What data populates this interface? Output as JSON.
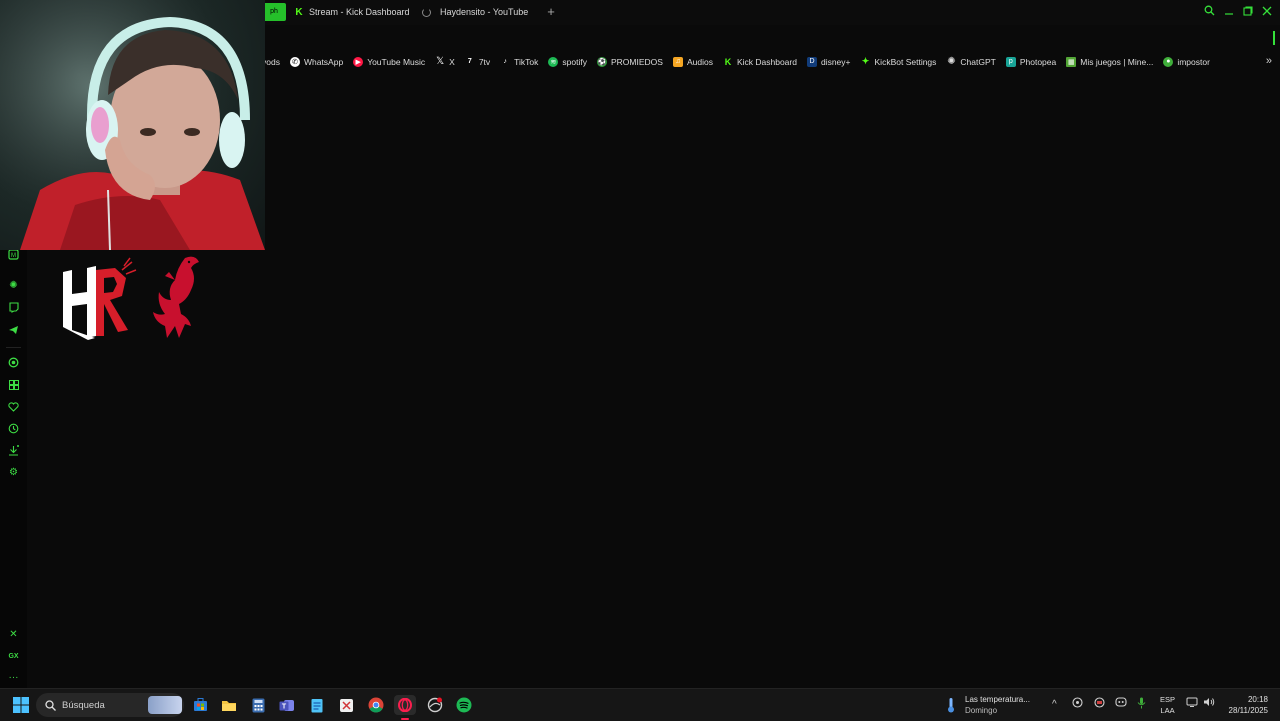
{
  "browser": {
    "active_tab_short": "ph",
    "tabs": [
      {
        "title": "Stream - Kick Dashboard",
        "icon": "kick-icon"
      },
      {
        "title": "Haydensito - YouTube",
        "icon": "loading-spinner-icon"
      }
    ],
    "new_tab_symbol": "+"
  },
  "bookmarks": [
    {
      "label": "vods",
      "icon": "kick-icon"
    },
    {
      "label": "WhatsApp",
      "icon": "whatsapp-icon"
    },
    {
      "label": "YouTube Music",
      "icon": "youtube-music-icon"
    },
    {
      "label": "X",
      "icon": "x-icon"
    },
    {
      "label": "7tv",
      "icon": "7tv-icon"
    },
    {
      "label": "TikTok",
      "icon": "tiktok-icon"
    },
    {
      "label": "spotify",
      "icon": "spotify-icon"
    },
    {
      "label": "PROMIEDOS",
      "icon": "promiedos-icon"
    },
    {
      "label": "Audios",
      "icon": "audios-icon"
    },
    {
      "label": "Kick Dashboard",
      "icon": "kick-icon"
    },
    {
      "label": "disney+",
      "icon": "disney-icon"
    },
    {
      "label": "KickBot Settings",
      "icon": "kickbot-icon"
    },
    {
      "label": "ChatGPT",
      "icon": "chatgpt-icon"
    },
    {
      "label": "Photopea",
      "icon": "photopea-icon"
    },
    {
      "label": "Mis juegos | Mine...",
      "icon": "minecraft-icon"
    },
    {
      "label": "impostor",
      "icon": "impostor-icon"
    }
  ],
  "logo": {
    "text": "HR"
  },
  "taskbar": {
    "search_placeholder": "Búsqueda",
    "weather_title": "Las temperatura...",
    "weather_sub": "Domingo",
    "lang_top": "ESP",
    "lang_bottom": "LAA",
    "time": "20:18",
    "date": "28/11/2025"
  },
  "colors": {
    "accent": "#25c02a",
    "kick_green": "#53fc18",
    "liverpool_red": "#c8102e"
  }
}
